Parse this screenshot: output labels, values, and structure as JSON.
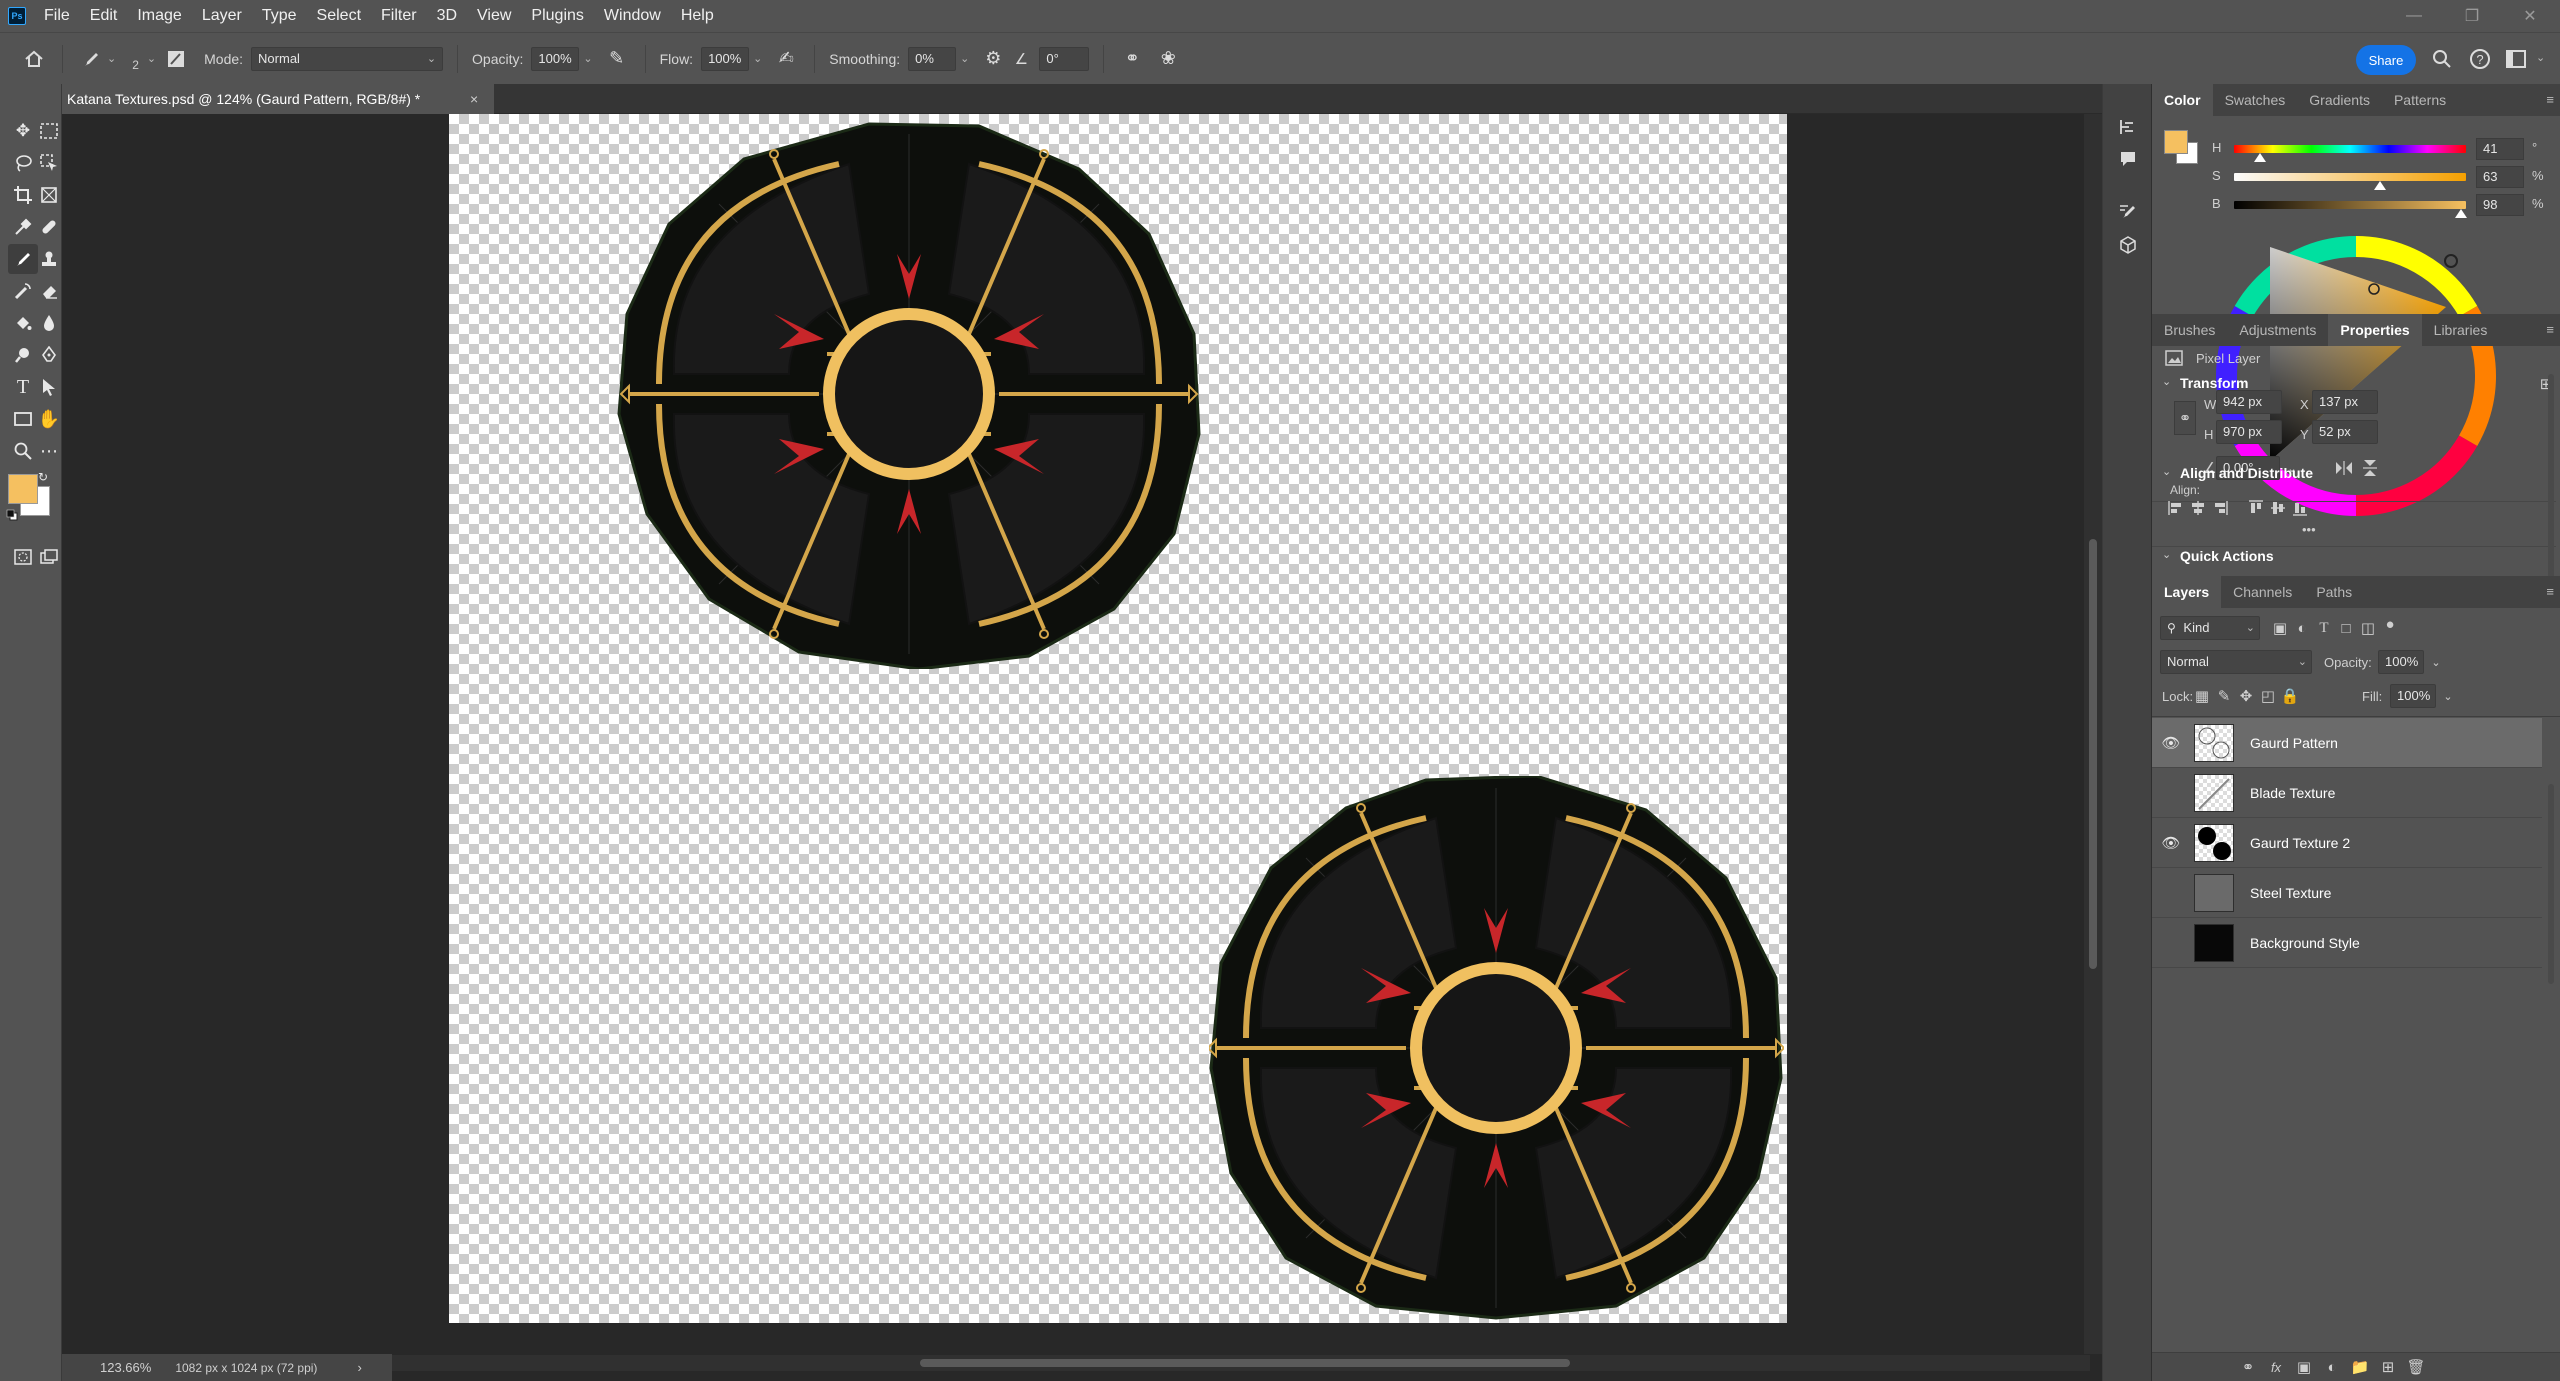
{
  "menubar": {
    "app_icon": "Ps",
    "items": [
      "File",
      "Edit",
      "Image",
      "Layer",
      "Type",
      "Select",
      "Filter",
      "3D",
      "View",
      "Plugins",
      "Window",
      "Help"
    ],
    "window_controls": [
      "minimize-icon",
      "restore-icon",
      "close-icon"
    ]
  },
  "options": {
    "brush_size": "2",
    "mode_label": "Mode:",
    "mode_value": "Normal",
    "opacity_label": "Opacity:",
    "opacity_value": "100%",
    "flow_label": "Flow:",
    "flow_value": "100%",
    "smoothing_label": "Smoothing:",
    "smoothing_value": "0%",
    "angle_value": "0°",
    "share_label": "Share"
  },
  "document": {
    "tab_title": "Katana Textures.psd @ 124% (Gaurd Pattern, RGB/8#) *",
    "close_glyph": "×"
  },
  "status": {
    "zoom": "123.66%",
    "doc_size": "1082 px x 1024 px (72 ppi)",
    "arrow": "›"
  },
  "color_panel": {
    "tabs": [
      "Color",
      "Swatches",
      "Gradients",
      "Patterns"
    ],
    "active_tab": "Color",
    "foreground_color": "#f5c060",
    "background_color": "#ffffff",
    "h": {
      "label": "H",
      "value": "41",
      "unit": "°",
      "level": 0.11
    },
    "s": {
      "label": "S",
      "value": "63",
      "unit": "%",
      "level": 0.63
    },
    "b": {
      "label": "B",
      "value": "98",
      "unit": "%",
      "level": 0.98
    }
  },
  "properties_panel": {
    "tabs": [
      "Brushes",
      "Adjustments",
      "Properties",
      "Libraries"
    ],
    "active_tab": "Properties",
    "layer_kind": "Pixel Layer",
    "transform_title": "Transform",
    "w_label": "W",
    "w_value": "942 px",
    "h_label": "H",
    "h_value": "970 px",
    "x_label": "X",
    "x_value": "137 px",
    "y_label": "Y",
    "y_value": "52 px",
    "angle_value": "0.00°",
    "align_title": "Align and Distribute",
    "align_label": "Align:",
    "more": "•••",
    "quick_actions_title": "Quick Actions"
  },
  "layers_panel": {
    "tabs": [
      "Layers",
      "Channels",
      "Paths"
    ],
    "active_tab": "Layers",
    "filter_kind": "Kind",
    "blend_mode": "Normal",
    "opacity_label": "Opacity:",
    "opacity_value": "100%",
    "lock_label": "Lock:",
    "fill_label": "Fill:",
    "fill_value": "100%",
    "layers": [
      {
        "name": "Gaurd Pattern",
        "visible": true,
        "selected": true
      },
      {
        "name": "Blade Texture",
        "visible": false,
        "selected": false
      },
      {
        "name": "Gaurd Texture 2",
        "visible": true,
        "selected": false
      },
      {
        "name": "Steel Texture",
        "visible": false,
        "selected": false
      },
      {
        "name": "Background Style",
        "visible": false,
        "selected": false
      }
    ]
  }
}
